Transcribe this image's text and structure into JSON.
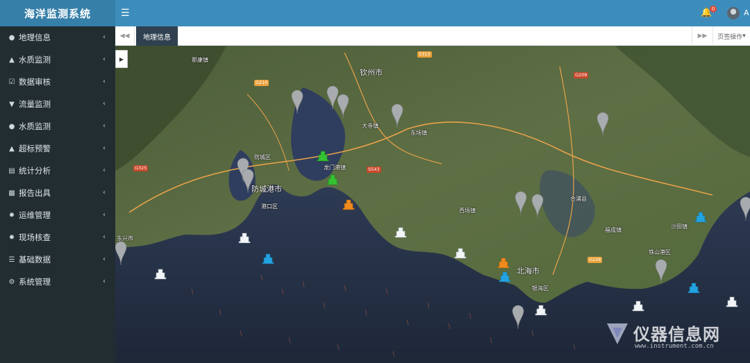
{
  "app": {
    "title": "海洋监测系统",
    "user": "A"
  },
  "header": {
    "notification_count": "0"
  },
  "sidebar": {
    "items": [
      {
        "label": "地理信息",
        "icon": "globe-icon"
      },
      {
        "label": "水质监测",
        "icon": "flask-icon"
      },
      {
        "label": "数据审核",
        "icon": "check-square-icon"
      },
      {
        "label": "流量监测",
        "icon": "filter-icon"
      },
      {
        "label": "水质监测",
        "icon": "droplet-icon"
      },
      {
        "label": "超标预警",
        "icon": "bell-icon"
      },
      {
        "label": "统计分析",
        "icon": "bar-chart-icon"
      },
      {
        "label": "报告出具",
        "icon": "printer-icon"
      },
      {
        "label": "运维管理",
        "icon": "cogs-icon"
      },
      {
        "label": "现场核查",
        "icon": "cogs-icon"
      },
      {
        "label": "基础数据",
        "icon": "database-icon"
      },
      {
        "label": "系统管理",
        "icon": "gear-icon"
      }
    ]
  },
  "tabs": {
    "active": "地理信息",
    "ops_label": "页签操作"
  },
  "map": {
    "places": {
      "qinzhou": "钦州市",
      "fangchenggang": "防城港市",
      "beihai": "北海市",
      "fangcheng_district": "防城区",
      "gangkou_district": "港口区",
      "tieshangang_district": "铁山港区",
      "yinhai_district": "银海区",
      "hepu": "合浦县",
      "longmen": "龙门港镇",
      "dongxing": "东兴市",
      "shatian": "沙田镇",
      "dashi": "大寺镇",
      "nakang": "那康镇",
      "fusen": "福成镇",
      "xichang": "西场镇",
      "dongchang": "东场镇"
    },
    "roads": [
      "S313",
      "G210",
      "S543",
      "G209",
      "G228",
      "G325"
    ]
  },
  "watermark": {
    "brand": "仪器信息网",
    "url": "www.instrument.com.cn"
  }
}
